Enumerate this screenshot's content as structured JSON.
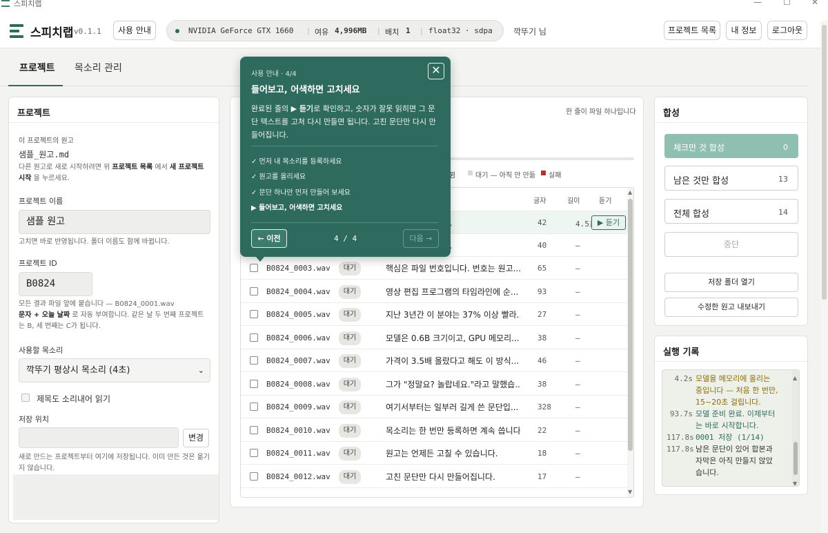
{
  "window": {
    "title": "스피치랩",
    "min": "—",
    "max": "☐",
    "close": "✕"
  },
  "header": {
    "brand": "스피치랩",
    "version": "v0.1.1",
    "guide_button": "사용 안내",
    "gpu": "NVIDIA GeForce GTX 1660",
    "free_label": "여유",
    "free_value": "4,996MB",
    "batch_label": "배치",
    "batch_value": "1",
    "precision": "float32 · sdpa",
    "user": "깍뚜기 님",
    "projects_button": "프로젝트 목록",
    "profile_button": "내 정보",
    "logout_button": "로그아웃"
  },
  "tabs": [
    {
      "label": "프로젝트"
    },
    {
      "label": "목소리 관리"
    }
  ],
  "left": {
    "title": "프로젝트",
    "source_label": "이 프로젝트의 원고",
    "source_file": "샘플_원고.md",
    "source_hint_1": "다른 원고로 새로 시작하려면 위 ",
    "source_hint_b1": "프로젝트 목록",
    "source_hint_2": " 에서 ",
    "source_hint_b2": "새 프로젝트",
    "source_hint_b3": "시작",
    "source_hint_3": " 을 누르세요.",
    "name_label": "프로젝트 이름",
    "name_value": "샘플 원고",
    "name_hint": "고치면 바로 반영됩니다. 폴더 이름도 함께 바뀝니다.",
    "id_label": "프로젝트 ID",
    "id_value": "B0824",
    "id_hint_1": "모든 결과 파일 앞에 붙습니다 — B0824_0001.wav",
    "id_hint_b": "문자 + 오늘 날짜",
    "id_hint_2": " 로 자동 부여합니다. 같은 날 두 번째 프로젝트",
    "id_hint_3": "는 B, 세 번째는 C가 됩니다.",
    "voice_label": "사용할 목소리",
    "voice_value": "깍뚜기 평상시 목소리 (4초)",
    "read_title_label": "제목도 소리내어 읽기",
    "save_label": "저장 위치",
    "save_value": "",
    "change_button": "변경",
    "save_hint": "새로 만드는 프로젝트부터 여기에 저장됩니다. 이미 만든 것은 옮기지 않습니다."
  },
  "center": {
    "note": "한 줄이 파일 하나입니다",
    "legend_done_part": "뀜",
    "legend_wait": "대기 — 아직 안 만듦",
    "legend_fail": "실패",
    "col_chars": "글자",
    "col_length": "길이",
    "col_listen": "듣기",
    "listen_button": "▶ 듣기",
    "rows": [
      {
        "file": "",
        "status": "",
        "text": "제 목소리로 내레...",
        "chars": "42",
        "dur": "4.5초"
      },
      {
        "file": "",
        "status": "",
        "text": "를 넣으면 문단마...",
        "chars": "40",
        "dur": "—"
      },
      {
        "file": "B0824_0003.wav",
        "status": "대기",
        "text": "핵심은 파일 번호입니다. 번호는 원고...",
        "chars": "65",
        "dur": "—"
      },
      {
        "file": "B0824_0004.wav",
        "status": "대기",
        "text": "영상 편집 프로그램의 타임라인에 순...",
        "chars": "93",
        "dur": "—"
      },
      {
        "file": "B0824_0005.wav",
        "status": "대기",
        "text": "지난 3년간 이 분야는 37% 이상 빨라...",
        "chars": "27",
        "dur": "—"
      },
      {
        "file": "B0824_0006.wav",
        "status": "대기",
        "text": "모델은 0.6B 크기이고, GPU 메모리...",
        "chars": "38",
        "dur": "—"
      },
      {
        "file": "B0824_0007.wav",
        "status": "대기",
        "text": "가격이 3.5배 올랐다고 해도 이 방식...",
        "chars": "46",
        "dur": "—"
      },
      {
        "file": "B0824_0008.wav",
        "status": "대기",
        "text": "그가 \"정말요? 놀랍네요.\"라고 말했습...",
        "chars": "38",
        "dur": "—"
      },
      {
        "file": "B0824_0009.wav",
        "status": "대기",
        "text": "여기서부터는 일부러 길게 쓴 문단입...",
        "chars": "328",
        "dur": "—"
      },
      {
        "file": "B0824_0010.wav",
        "status": "대기",
        "text": "목소리는 한 번만 등록하면 계속 씁니다.",
        "chars": "22",
        "dur": "—"
      },
      {
        "file": "B0824_0011.wav",
        "status": "대기",
        "text": "원고는 언제든 고칠 수 있습니다.",
        "chars": "18",
        "dur": "—"
      },
      {
        "file": "B0824_0012.wav",
        "status": "대기",
        "text": "고친 문단만 다시 만들어집니다.",
        "chars": "17",
        "dur": "—"
      }
    ]
  },
  "right": {
    "title": "합성",
    "checked_button": "체크만 것 합성",
    "checked_count": "0",
    "remaining_button": "남은 것만 합성",
    "remaining_count": "13",
    "all_button": "전체 합성",
    "all_count": "14",
    "stop_button": "중단",
    "open_folder_button": "저장 폴더 열기",
    "export_button": "수정한 원고 내보내기",
    "log_title": "실행 기록",
    "log": [
      {
        "t": "4.2s",
        "m": "모델을 메모리에 올리는 중입니다 — 처음 한 번만, 15~20초 걸립니다."
      },
      {
        "t": "93.7s",
        "m": "모델 준비 완료. 이제부터는 바로 시작합니다."
      },
      {
        "t": "117.8s",
        "m": "0001 저장 (1/14)"
      },
      {
        "t": "117.8s",
        "m": "남은 문단이 있어 합본과 자막은 아직 만들지 않았습니다."
      }
    ]
  },
  "tooltip": {
    "step": "사용 안내 · 4/4",
    "title": "들어보고, 어색하면 고치세요",
    "desc_1": "완료된 줄의 ",
    "desc_b": "▶ 듣기",
    "desc_2": "로 확인하고, 숫자가 잘못 읽히면 그 문단 텍스트를 고쳐 다시 만들면 됩니다. 고친 문단만 다시 만들어집니다.",
    "checklist": [
      {
        "label": "✓ 먼저 내 목소리를 등록하세요"
      },
      {
        "label": "✓ 원고를 올리세요"
      },
      {
        "label": "✓ 문단 하나만 먼저 만들어 보세요"
      },
      {
        "label": "▶ 들어보고, 어색하면 고치세요"
      }
    ],
    "prev_button": "← 이전",
    "page": "4 / 4",
    "next_button": "다음 →",
    "close": "✕"
  },
  "colors": {
    "accent": "#2f6a5e",
    "accent_light": "#8fbfb0",
    "fail": "#b8322a"
  }
}
